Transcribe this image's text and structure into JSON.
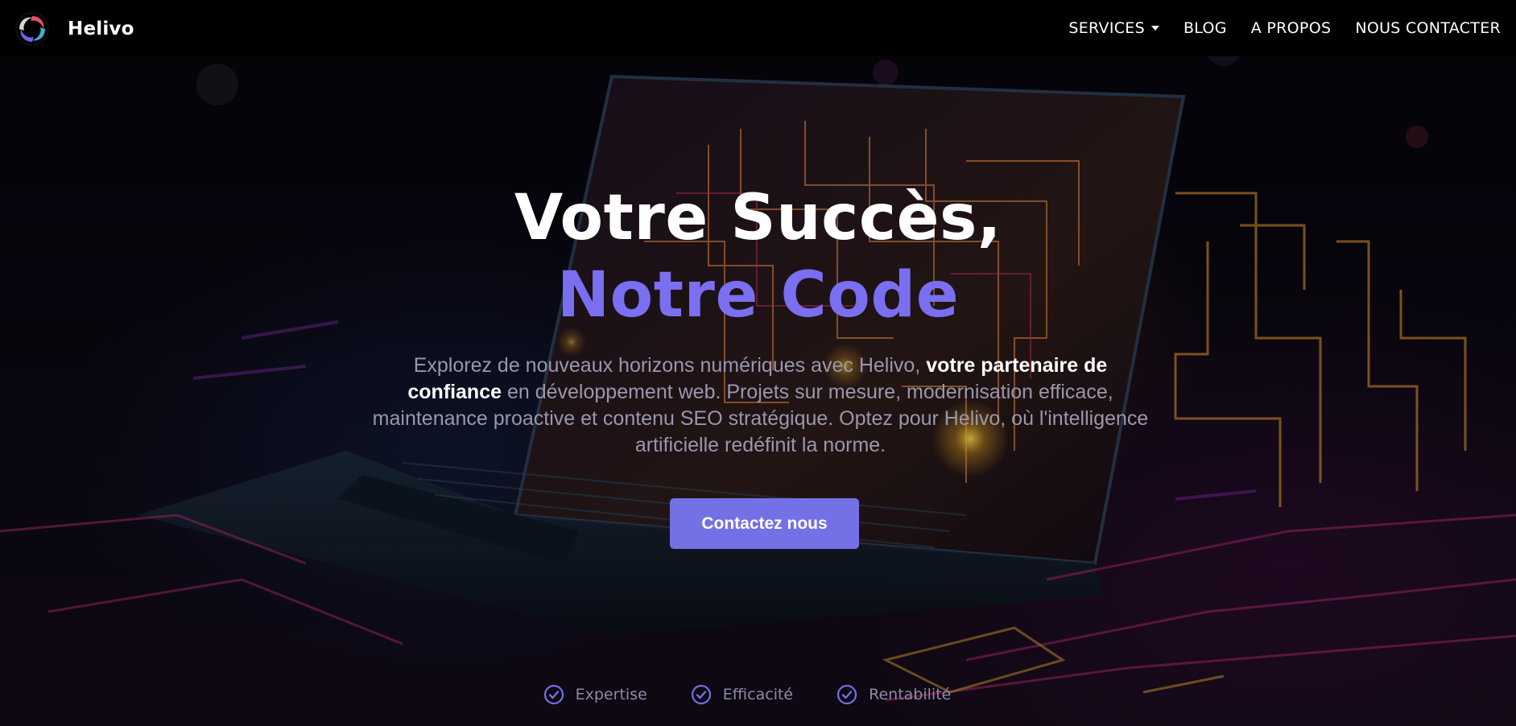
{
  "brand": {
    "name": "Helivo",
    "logo_icon": "helivo-swirl-logo-icon"
  },
  "nav": {
    "items": [
      {
        "label": "SERVICES",
        "has_dropdown": true
      },
      {
        "label": "BLOG",
        "has_dropdown": false
      },
      {
        "label": "A PROPOS",
        "has_dropdown": false
      },
      {
        "label": "NOUS CONTACTER",
        "has_dropdown": false
      }
    ]
  },
  "hero": {
    "title_line1": "Votre Succès,",
    "title_line2": "Notre Code",
    "description_before": "Explorez de nouveaux horizons numériques avec Helivo, ",
    "description_highlight": "votre partenaire de confiance",
    "description_after": " en développement web. Projets sur mesure, modernisation efficace, maintenance proactive et contenu SEO stratégique. Optez pour Helivo, où l'intelligence artificielle redéfinit la norme.",
    "cta_label": "Contactez nous"
  },
  "features": [
    {
      "label": "Expertise",
      "icon": "check-circle-icon"
    },
    {
      "label": "Efficacité",
      "icon": "check-circle-icon"
    },
    {
      "label": "Rentabilité",
      "icon": "check-circle-icon"
    }
  ],
  "colors": {
    "accent": "#7470e6",
    "title_accent": "#7a6ff0",
    "nav_bg": "#000000",
    "text_muted": "#9a97ad"
  }
}
